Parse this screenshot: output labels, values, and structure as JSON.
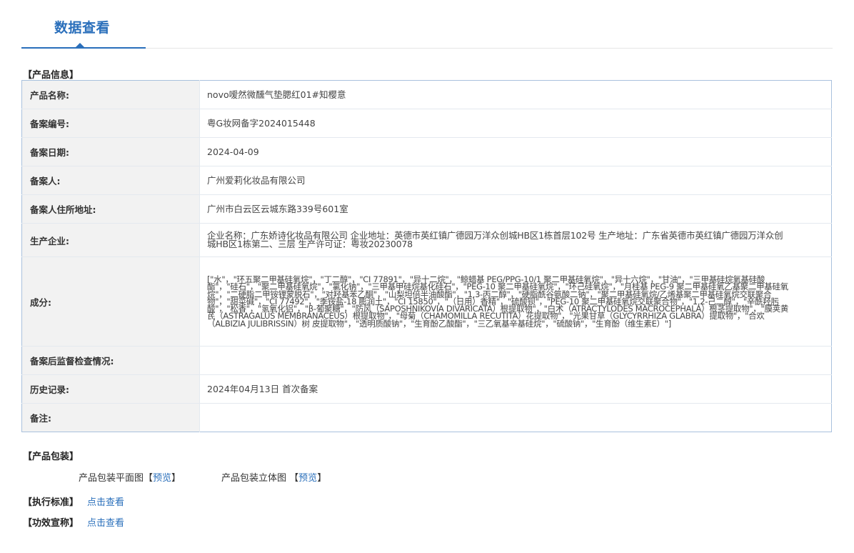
{
  "header": {
    "tab_label": "数据查看"
  },
  "product_info": {
    "section_title": "【产品信息】",
    "rows": [
      {
        "label": "产品名称:",
        "value": "novo嗳然微醺气垫腮红01#知樱意"
      },
      {
        "label": "备案编号:",
        "value": "粤G妆网备字2024015448"
      },
      {
        "label": "备案日期:",
        "value": "2024-04-09"
      },
      {
        "label": "备案人:",
        "value": "广州爱莉化妆品有限公司"
      },
      {
        "label": "备案人住所地址:",
        "value": "广州市白云区云城东路339号601室"
      },
      {
        "label": "生产企业:",
        "value": "企业名称：广东娇诗化妆品有限公司 企业地址：英德市英红镇广德园万洋众创城HB区1栋首层102号 生产地址：广东省英德市英红镇广德园万洋众创城HB区1栋第二、三层 生产许可证：粤妆20230078"
      },
      {
        "label": "成分:",
        "value": "[\"水\"，\"环五聚二甲基硅氧烷\"，\"丁二醇\"，\"CI 77891\"，\"异十二烷\"，\"鲸蜡基 PEG/PPG-10/1 聚二甲基硅氧烷\"，\"异十六烷\"，\"甘油\"，\"三甲基硅烷氧基硅酸酯\"，\"硅石\"，\"聚二甲基硅氧烷\"，\"氯化钠\"，\"三甲基甲硅烷基化硅石\"，\"PEG-10 聚二甲基硅氧烷\"，\"环己硅氧烷\"，\"月桂基 PEG-9 聚二甲基硅氧乙基聚二甲基硅氧烷\"，\"二硬脂二甲铵锂蒙脱石\"，\"对羟基苯乙酮\"，\"山梨坦倍半油酸酯\"，\"1,3-丙二醇\"，\"硬脂酰谷氨酸二钠\"，\"聚二甲基硅氧烷/乙烯基聚二甲基硅氧烷交联聚合物\"，\"甜菜碱\"，\"CI 77492\"，\"季铵盐-18 膨润土\"，\"CI 15850\"，\"（日用）香精\"，\"硫酸钡\"，\"PEG-10 聚二甲基硅氧烷交联聚合物\"，\"1,2-己二醇\"，\"辛酰羟肟酸\"，\"松香\"，\"氢氧化铝\"，\"β-葡聚糖\"，\"防风（SAPOSHNIKOVIA DIVARICATA）根提取物\"，\"白术（ATRACTYLODES MACROCEPHALA）根茎提取物\"，\"膜荚黄芪（ASTRAGALUS MEMBRANACEUS）根提取物\"，\"母菊（CHAMOMILLA RECUTITA）花提取物\"，\"光果甘草（GLYCYRRHIZA GLABRA）提取物\"，\"合欢（ALBIZIA JULIBRISSIN）树 皮提取物\"，\"透明质酸钠\"，\"生育酚乙酸酯\"，\"三乙氧基辛基硅烷\"，\"硫酸钠\"，\"生育酚（维生素E）\"]"
      },
      {
        "label": "备案后监督检查情况:",
        "value": ""
      },
      {
        "label": "历史记录:",
        "value": "2024年04月13日 首次备案"
      },
      {
        "label": "备注:",
        "value": ""
      }
    ]
  },
  "packaging": {
    "section_title": "【产品包装】",
    "flat_label": "产品包装平面图",
    "stereo_label": "产品包装立体图",
    "bracket_open": "【",
    "bracket_close": "】",
    "preview_link": "预览"
  },
  "standards": {
    "tag": "【执行标准】",
    "link": "点击查看"
  },
  "efficacy": {
    "tag": "【功效宣称】",
    "link": "点击查看"
  }
}
